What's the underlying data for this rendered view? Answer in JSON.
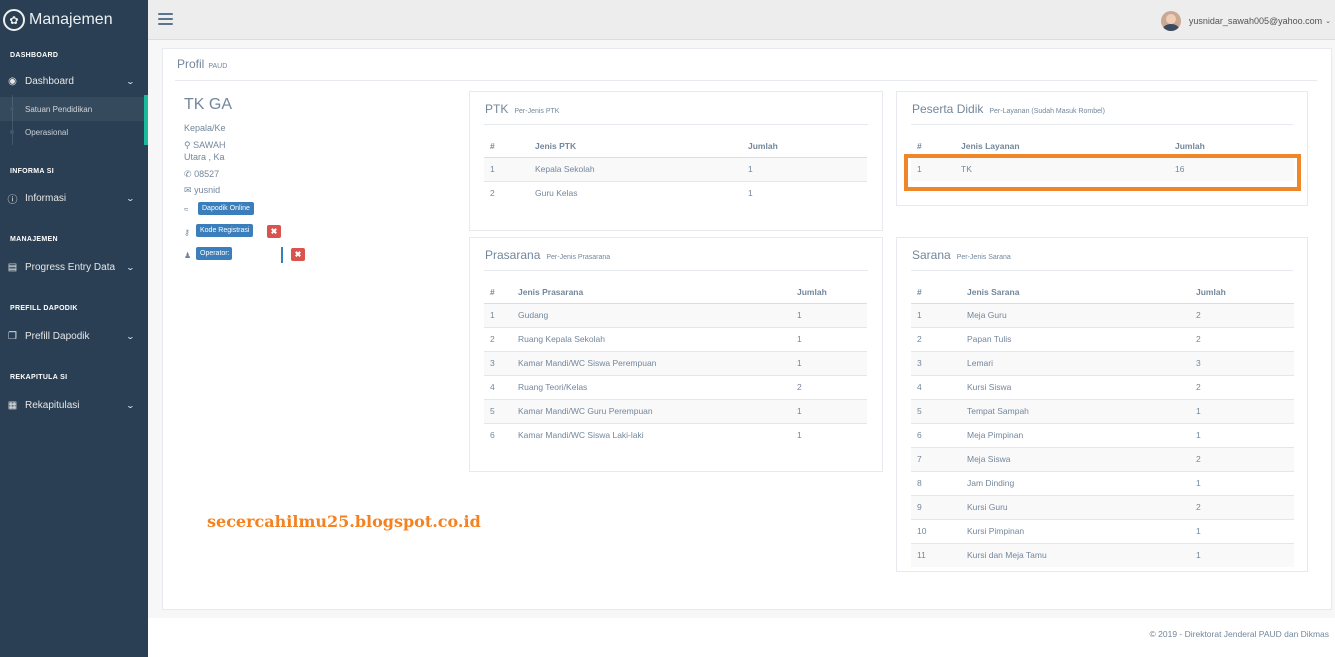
{
  "sidebar": {
    "brand": "Manajemen",
    "sections": {
      "dashboard": "DASHBOARD",
      "informasi": "INFORMA SI",
      "manajemen": "MANAJEMEN",
      "prefill": "PREFILL DAPODIK",
      "rekap": "REKAPITULA SI"
    },
    "menu": {
      "dashboard": "Dashboard",
      "satuan": "Satuan Pendidikan",
      "operasional": "Operasional",
      "informasi": "Informasi",
      "progress": "Progress Entry Data",
      "prefill": "Prefill Dapodik",
      "rekap": "Rekapitulasi"
    }
  },
  "topnav": {
    "user": "yusnidar_sawah005@yahoo.com"
  },
  "page": {
    "title": "Profil",
    "subtitle": "PAUD"
  },
  "profile": {
    "name": "TK GA",
    "head": "Kepala/Ke",
    "addr1": "SAWAH",
    "addr2": "Utara , Ka",
    "phone": "08527",
    "email": "yusnid",
    "btn_online": "Dapodik Online",
    "btn_kode": "Kode Registrasi",
    "btn_operator": "Operator:"
  },
  "ptk": {
    "title": "PTK",
    "subtitle": "Per-Jenis PTK",
    "headers": [
      "#",
      "Jenis PTK",
      "Jumlah"
    ],
    "rows": [
      [
        "1",
        "Kepala Sekolah",
        "1"
      ],
      [
        "2",
        "Guru Kelas",
        "1"
      ]
    ]
  },
  "peserta": {
    "title": "Peserta Didik",
    "subtitle": "Per-Layanan (Sudah Masuk Rombel)",
    "headers": [
      "#",
      "Jenis Layanan",
      "Jumlah"
    ],
    "rows": [
      [
        "1",
        "TK",
        "16"
      ]
    ]
  },
  "prasarana": {
    "title": "Prasarana",
    "subtitle": "Per-Jenis Prasarana",
    "headers": [
      "#",
      "Jenis Prasarana",
      "Jumlah"
    ],
    "rows": [
      [
        "1",
        "Gudang",
        "1"
      ],
      [
        "2",
        "Ruang Kepala Sekolah",
        "1"
      ],
      [
        "3",
        "Kamar Mandi/WC Siswa Perempuan",
        "1"
      ],
      [
        "4",
        "Ruang Teori/Kelas",
        "2"
      ],
      [
        "5",
        "Kamar Mandi/WC Guru Perempuan",
        "1"
      ],
      [
        "6",
        "Kamar Mandi/WC Siswa Laki-laki",
        "1"
      ]
    ]
  },
  "sarana": {
    "title": "Sarana",
    "subtitle": "Per-Jenis Sarana",
    "headers": [
      "#",
      "Jenis Sarana",
      "Jumlah"
    ],
    "rows": [
      [
        "1",
        "Meja Guru",
        "2"
      ],
      [
        "2",
        "Papan Tulis",
        "2"
      ],
      [
        "3",
        "Lemari",
        "3"
      ],
      [
        "4",
        "Kursi Siswa",
        "2"
      ],
      [
        "5",
        "Tempat Sampah",
        "1"
      ],
      [
        "6",
        "Meja Pimpinan",
        "1"
      ],
      [
        "7",
        "Meja Siswa",
        "2"
      ],
      [
        "8",
        "Jam Dinding",
        "1"
      ],
      [
        "9",
        "Kursi Guru",
        "2"
      ],
      [
        "10",
        "Kursi Pimpinan",
        "1"
      ],
      [
        "11",
        "Kursi dan Meja Tamu",
        "1"
      ]
    ]
  },
  "watermark": "secercahilmu25.blogspot.co.id",
  "footer": "©   2019 - Direktorat Jenderal PAUD dan Dikmas",
  "colors": {
    "sidebar": "#2A3F54",
    "accent": "#1ABB9C",
    "button_blue": "#3A7EBB",
    "button_red": "#D9534F",
    "highlight": "#F0862A",
    "watermark": "#F58220"
  }
}
